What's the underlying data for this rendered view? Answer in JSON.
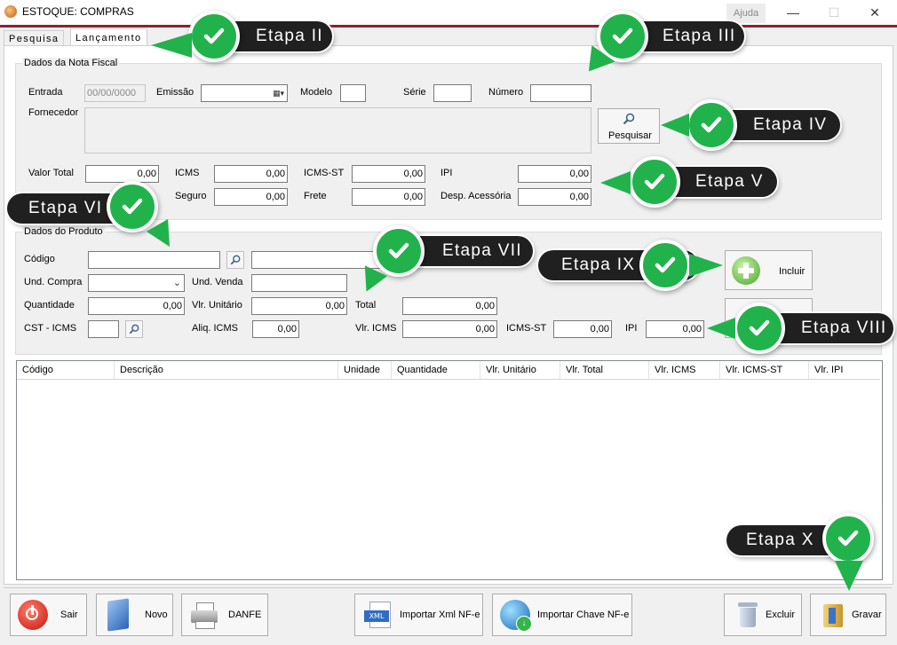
{
  "window": {
    "title": "ESTOQUE: COMPRAS",
    "help_menu": "Ajuda"
  },
  "tabs": [
    {
      "label": "Pesquisa"
    },
    {
      "label": "Lançamento"
    }
  ],
  "nota": {
    "legend": "Dados da Nota Fiscal",
    "entrada_label": "Entrada",
    "entrada_value": "00/00/0000",
    "emissao_label": "Emissão",
    "emissao_value": "",
    "modelo_label": "Modelo",
    "serie_label": "Série",
    "numero_label": "Número",
    "fornecedor_label": "Fornecedor",
    "pesquisar_label": "Pesquisar",
    "valor_total_label": "Valor Total",
    "valor_total": "0,00",
    "icms_label": "ICMS",
    "icms": "0,00",
    "icms_st_label": "ICMS-ST",
    "icms_st": "0,00",
    "ipi_label": "IPI",
    "ipi": "0,00",
    "seguro_label": "Seguro",
    "seguro": "0,00",
    "frete_label": "Frete",
    "frete": "0,00",
    "desp_label": "Desp. Acessória",
    "desp": "0,00"
  },
  "produto": {
    "legend": "Dados do Produto",
    "codigo_label": "Código",
    "und_compra_label": "Und. Compra",
    "und_venda_label": "Und. Venda",
    "quantidade_label": "Quantidade",
    "quantidade": "0,00",
    "vlr_unitario_label": "Vlr. Unitário",
    "vlr_unitario": "0,00",
    "total_label": "Total",
    "total": "0,00",
    "cst_label": "CST - ICMS",
    "aliq_label": "Aliq. ICMS",
    "aliq": "0,00",
    "vlr_icms_label": "Vlr. ICMS",
    "vlr_icms": "0,00",
    "icms_st_label": "ICMS-ST",
    "icms_st": "0,00",
    "ipi_label": "IPI",
    "ipi": "0,00",
    "incluir_label": "Incluir"
  },
  "grid": {
    "columns": [
      "Código",
      "Descrição",
      "Unidade",
      "Quantidade",
      "Vlr. Unitário",
      "Vlr. Total",
      "Vlr. ICMS",
      "Vlr. ICMS-ST",
      "Vlr. IPI"
    ]
  },
  "toolbar": {
    "sair": "Sair",
    "novo": "Novo",
    "danfe": "DANFE",
    "importar_xml": "Importar Xml NF-e",
    "importar_chave": "Importar Chave NF-e",
    "excluir": "Excluir",
    "gravar": "Gravar",
    "xml_icon_text": "XML"
  },
  "callouts": {
    "etapa2": "Etapa II",
    "etapa3": "Etapa III",
    "etapa4": "Etapa IV",
    "etapa5": "Etapa V",
    "etapa6": "Etapa VI",
    "etapa7": "Etapa VII",
    "etapa8": "Etapa VIII",
    "etapa9": "Etapa IX",
    "etapa10": "Etapa X"
  },
  "colors": {
    "accent": "#8e2130",
    "check_green": "#22b24c",
    "callout_dark": "#202020"
  }
}
